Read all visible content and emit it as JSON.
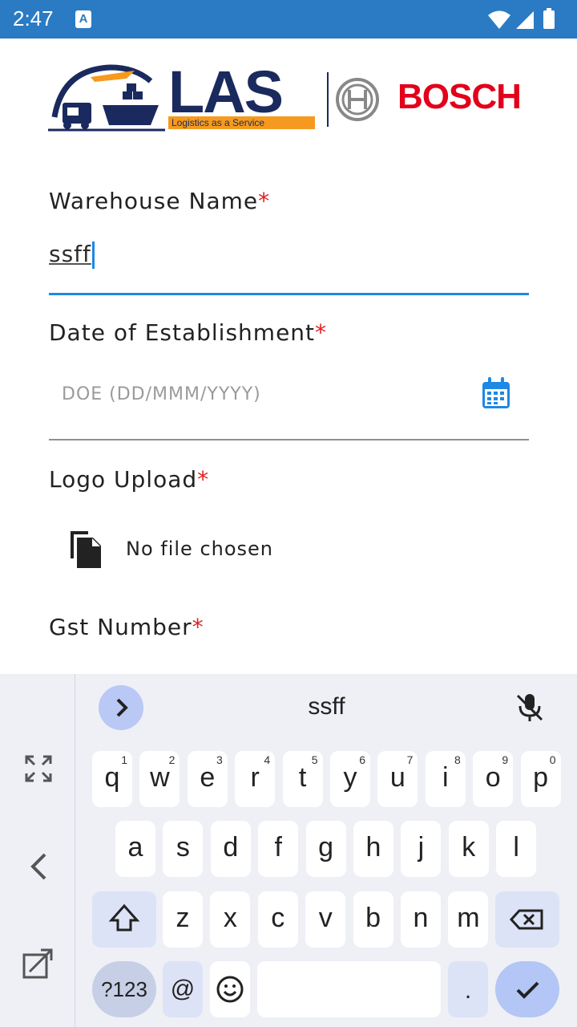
{
  "status_bar": {
    "time": "2:47",
    "notification_icon": "A"
  },
  "logo": {
    "brand": "LAS",
    "tagline": "Logistics as a Service",
    "partner": "BOSCH"
  },
  "form": {
    "warehouse_name": {
      "label": "Warehouse Name",
      "required_mark": "*",
      "value": "ssff"
    },
    "date_of_establishment": {
      "label": "Date of Establishment",
      "required_mark": "*",
      "placeholder": "DOE (DD/MMM/YYYY)"
    },
    "logo_upload": {
      "label": "Logo Upload",
      "required_mark": "*",
      "status": "No file chosen"
    },
    "gst_number": {
      "label": "Gst Number",
      "required_mark": "*"
    }
  },
  "keyboard": {
    "suggestion": "ssff",
    "row1": [
      {
        "key": "q",
        "hint": "1"
      },
      {
        "key": "w",
        "hint": "2"
      },
      {
        "key": "e",
        "hint": "3"
      },
      {
        "key": "r",
        "hint": "4"
      },
      {
        "key": "t",
        "hint": "5"
      },
      {
        "key": "y",
        "hint": "6"
      },
      {
        "key": "u",
        "hint": "7"
      },
      {
        "key": "i",
        "hint": "8"
      },
      {
        "key": "o",
        "hint": "9"
      },
      {
        "key": "p",
        "hint": "0"
      }
    ],
    "row2": [
      "a",
      "s",
      "d",
      "f",
      "g",
      "h",
      "j",
      "k",
      "l"
    ],
    "row3": [
      "z",
      "x",
      "c",
      "v",
      "b",
      "n",
      "m"
    ],
    "symbols_label": "?123",
    "at_label": "@",
    "period_label": "."
  },
  "colors": {
    "status_bar": "#2a7bc4",
    "accent": "#1e88e5",
    "required": "#e02020",
    "brand_navy": "#1a2a5e",
    "bosch_red": "#e2001a"
  }
}
